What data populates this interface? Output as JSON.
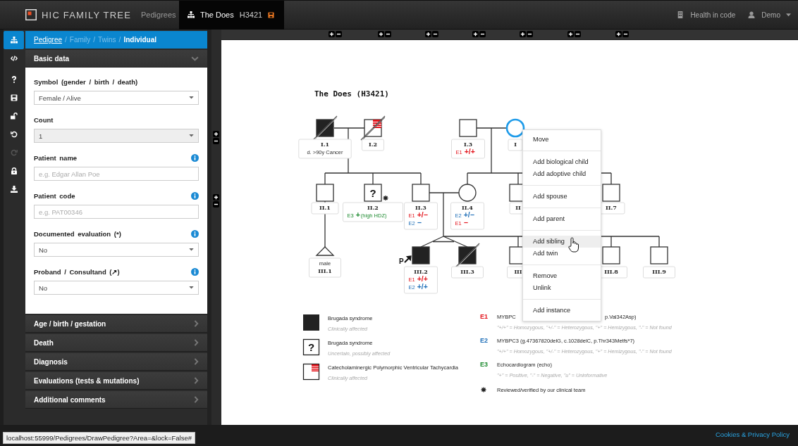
{
  "navbar": {
    "brand": "HIC FAMILY TREE",
    "links": [
      {
        "label": "Pedigrees",
        "selected": false
      }
    ],
    "active_tab": {
      "title": "The Does",
      "code": "H3421"
    },
    "organization": "Health in code",
    "user": "Demo"
  },
  "tools": [
    {
      "kind": "pedigree",
      "selected": true,
      "disabled": false
    },
    {
      "kind": "code",
      "selected": false,
      "disabled": false
    },
    {
      "kind": "help",
      "selected": false,
      "disabled": false
    },
    {
      "kind": "save",
      "selected": false,
      "disabled": false
    },
    {
      "kind": "unlock",
      "selected": false,
      "disabled": false
    },
    {
      "kind": "undo",
      "selected": false,
      "disabled": false
    },
    {
      "kind": "redo",
      "selected": false,
      "disabled": true
    },
    {
      "kind": "lock-user",
      "selected": false,
      "disabled": false
    },
    {
      "kind": "download",
      "selected": false,
      "disabled": false
    }
  ],
  "breadcrumb": {
    "separator": "/",
    "items": [
      {
        "label": "Pedigree",
        "kind": "link"
      },
      {
        "label": "Family",
        "kind": "dim"
      },
      {
        "label": "Twins",
        "kind": "dim"
      },
      {
        "label": "Individual",
        "kind": "current"
      }
    ]
  },
  "sections": [
    {
      "title": "Basic data",
      "expanded": true
    },
    {
      "title": "Age / birth / gestation",
      "expanded": false
    },
    {
      "title": "Death",
      "expanded": false
    },
    {
      "title": "Diagnosis",
      "expanded": false
    },
    {
      "title": "Evaluations (tests & mutations)",
      "expanded": false
    },
    {
      "title": "Additional comments",
      "expanded": false
    }
  ],
  "form": [
    {
      "label": "Symbol (gender / birth / death)",
      "kind": "select",
      "value": "Female / Alive",
      "info": false,
      "disabled": false
    },
    {
      "label": "Count",
      "kind": "select",
      "value": "1",
      "info": false,
      "disabled": true
    },
    {
      "label": "Patient name",
      "kind": "input",
      "placeholder": "e.g. Edgar Allan Poe",
      "info": true,
      "disabled": false
    },
    {
      "label": "Patient code",
      "kind": "input",
      "placeholder": "e.g. PAT00346",
      "info": true,
      "disabled": false
    },
    {
      "label": "Documented evaluation (*)",
      "kind": "select",
      "value": "No",
      "info": true,
      "disabled": false
    },
    {
      "label": "Proband / Consultand (↗)",
      "kind": "select",
      "value": "No",
      "info": true,
      "disabled": false
    }
  ],
  "pedigree": {
    "title": "The Does (H3421)",
    "individuals": [
      {
        "kind": "square",
        "affected": true,
        "deceased": true,
        "partial": false,
        "selected": false,
        "lines": [
          {
            "kind": "id",
            "text": "I.1"
          },
          {
            "kind": "note",
            "text": "d. >90y Cancer"
          }
        ]
      },
      {
        "kind": "square",
        "affected": false,
        "deceased": true,
        "partial": true,
        "selected": false,
        "lines": [
          {
            "kind": "id",
            "text": "I.2"
          }
        ]
      },
      {
        "kind": "square",
        "affected": false,
        "deceased": false,
        "partial": false,
        "selected": false,
        "lines": [
          {
            "kind": "id",
            "text": "I.3"
          },
          {
            "kind": "genotype",
            "test": "E1",
            "result": "+/+",
            "color": "#e3131b"
          }
        ]
      },
      {
        "kind": "circle",
        "affected": false,
        "deceased": false,
        "selected": true,
        "lines": [
          {
            "kind": "id",
            "text": "I"
          }
        ]
      },
      {
        "kind": "square",
        "affected": false,
        "deceased": false,
        "partial": false,
        "selected": false,
        "lines": [
          {
            "kind": "id",
            "text": "II.1"
          }
        ]
      },
      {
        "kind": "square",
        "affected": false,
        "deceased": false,
        "partial": false,
        "selected": false,
        "uncertain_mark": "?",
        "verified": true,
        "lines": [
          {
            "kind": "id",
            "text": "II.2"
          },
          {
            "kind": "genotype",
            "test": "E3",
            "result": "+",
            "detail": "(high HDZ)",
            "color": "#1c8a2e"
          }
        ]
      },
      {
        "kind": "square",
        "affected": false,
        "deceased": false,
        "partial": false,
        "selected": false,
        "lines": [
          {
            "kind": "id",
            "text": "II.3"
          },
          {
            "kind": "genotype",
            "test": "E1",
            "result": "+/−",
            "color": "#e3131b"
          },
          {
            "kind": "genotype",
            "test": "E2",
            "result": "−",
            "color": "#1f6fb8"
          }
        ]
      },
      {
        "kind": "circle",
        "affected": false,
        "deceased": false,
        "selected": false,
        "lines": [
          {
            "kind": "id",
            "text": "II.4"
          },
          {
            "kind": "genotype",
            "test": "E2",
            "result": "+/−",
            "color": "#1f6fb8"
          },
          {
            "kind": "genotype",
            "test": "E1",
            "result": "−",
            "color": "#e3131b"
          }
        ]
      },
      {
        "kind": "square",
        "affected": false,
        "deceased": false,
        "partial": false,
        "selected": false,
        "lines": [
          {
            "kind": "id",
            "text": "II"
          }
        ]
      },
      {
        "kind": "square",
        "affected": false,
        "deceased": false,
        "partial": false,
        "selected": false,
        "lines": [
          {
            "kind": "id",
            "text": "II.7"
          }
        ]
      },
      {
        "kind": "triangle",
        "affected": false,
        "selected": false,
        "lines": [
          {
            "kind": "note",
            "text": "male"
          },
          {
            "kind": "id",
            "text": "III.1"
          }
        ]
      },
      {
        "kind": "square",
        "affected": true,
        "deceased": false,
        "partial": false,
        "selected": false,
        "proband_mark": "P",
        "lines": [
          {
            "kind": "id",
            "text": "III.2"
          },
          {
            "kind": "genotype",
            "test": "E1",
            "result": "+/+",
            "color": "#e3131b"
          },
          {
            "kind": "genotype",
            "test": "E2",
            "result": "+/+",
            "color": "#1f6fb8"
          }
        ]
      },
      {
        "kind": "square",
        "affected": true,
        "deceased": true,
        "partial": false,
        "selected": false,
        "lines": [
          {
            "kind": "id",
            "text": "III.3"
          }
        ]
      },
      {
        "kind": "square",
        "affected": false,
        "deceased": false,
        "partial": false,
        "selected": false,
        "lines": [
          {
            "kind": "id",
            "text": "III"
          }
        ]
      },
      {
        "kind": "square",
        "affected": false,
        "deceased": false,
        "partial": false,
        "selected": false,
        "lines": [
          {
            "kind": "id",
            "text": "III.8"
          }
        ]
      },
      {
        "kind": "square",
        "affected": false,
        "deceased": false,
        "partial": false,
        "selected": false,
        "lines": [
          {
            "kind": "id",
            "text": "III.9"
          }
        ]
      }
    ],
    "legend_symbols": [
      {
        "kind": "affected",
        "name": "Brugada syndrome",
        "status": "Clinically affected"
      },
      {
        "kind": "uncertain",
        "mark": "?",
        "name": "Brugada syndrome",
        "status": "Uncertain, possibly affected"
      },
      {
        "kind": "partial",
        "name": "Catecholaminergic Polymorphic Ventricular Tachycardia",
        "status": "Clinically affected"
      }
    ],
    "legend_evaluations": [
      {
        "code": "E1",
        "color": "#e3131b",
        "title_start": "MYBPC",
        "title_end": "p.Val342Asp)",
        "note": "\"+/+\" = Homozygous, \"+/-\" = Heterozygous, \"+\" = Hemizygous, \"-\" = Not found"
      },
      {
        "code": "E2",
        "color": "#1f6fb8",
        "title_start": "MYBPC3 (g.47367820delG, c.1028delC, p.Thr343Metfs*7)",
        "note": "\"+/+\" = Homozygous, \"+/-\" = Heterozygous, \"+\" = Hemizygous, \"-\" = Not found"
      },
      {
        "code": "E3",
        "color": "#1c8a2e",
        "title_start": "Echocardiogram (echo)",
        "note": "\"+\" = Positive, \"-\" = Negative, \"u\" = Uninformative"
      }
    ],
    "legend_verified": "Reviewed/verified by our clinical team"
  },
  "context_menu": [
    [
      {
        "label": "Move",
        "highlighted": false
      }
    ],
    [
      {
        "label": "Add biological child",
        "highlighted": false
      },
      {
        "label": "Add adoptive child",
        "highlighted": false
      }
    ],
    [
      {
        "label": "Add spouse",
        "highlighted": false
      }
    ],
    [
      {
        "label": "Add parent",
        "highlighted": false
      }
    ],
    [
      {
        "label": "Add sibling",
        "highlighted": true
      },
      {
        "label": "Add twin",
        "highlighted": false
      }
    ],
    [
      {
        "label": "Remove",
        "highlighted": false
      },
      {
        "label": "Unlink",
        "highlighted": false
      }
    ],
    [
      {
        "label": "Add instance",
        "highlighted": false
      }
    ]
  ],
  "footer": {
    "link": "Cookies & Privacy Policy",
    "status_url": "localhost:55999/Pedigrees/DrawPedigree?Area=&lock=False#"
  }
}
